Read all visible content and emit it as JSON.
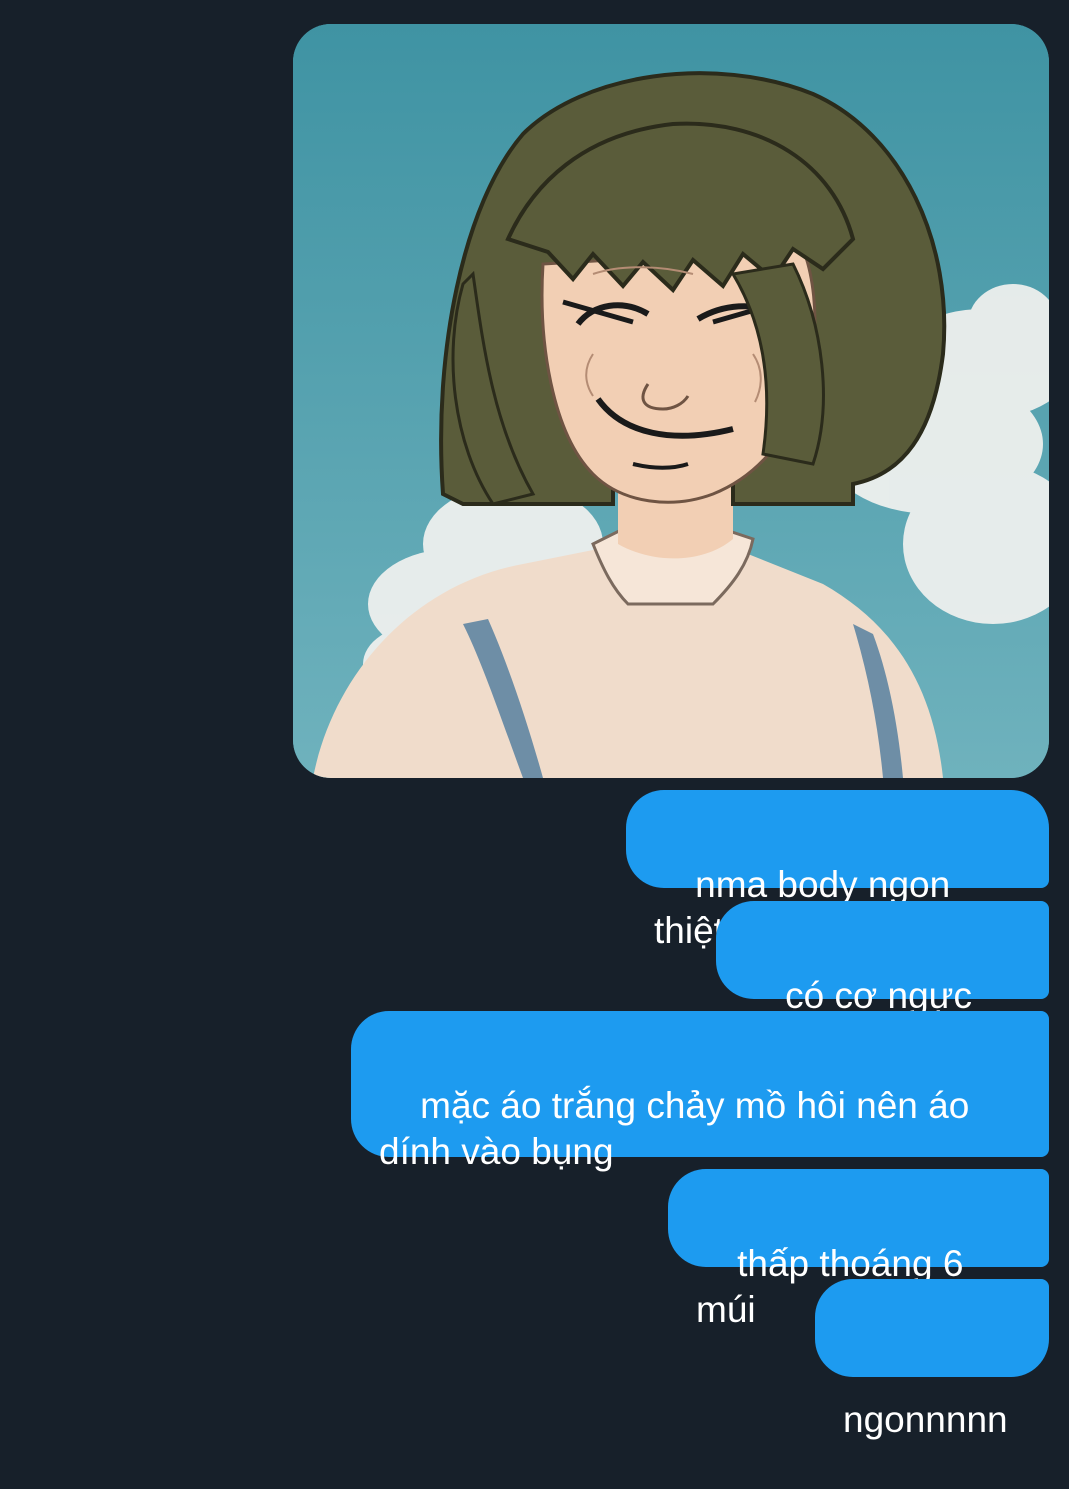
{
  "conversation": {
    "image": {
      "description_icon": "anime-character-image",
      "sky_color": "#4a9aa8",
      "hair_color": "#5a5c3a",
      "skin_color": "#f2cfb4"
    },
    "messages": [
      {
        "text": "nma body ngon thiệt"
      },
      {
        "text": "có cơ ngực nữa"
      },
      {
        "text": "mặc áo trắng chảy mồ hôi nên áo\ndính vào bụng"
      },
      {
        "text": "thấp thoáng 6 múi"
      },
      {
        "text": "ngonnnnn"
      }
    ],
    "bubble_color": "#1d9bf0",
    "background_color": "#17202a"
  }
}
